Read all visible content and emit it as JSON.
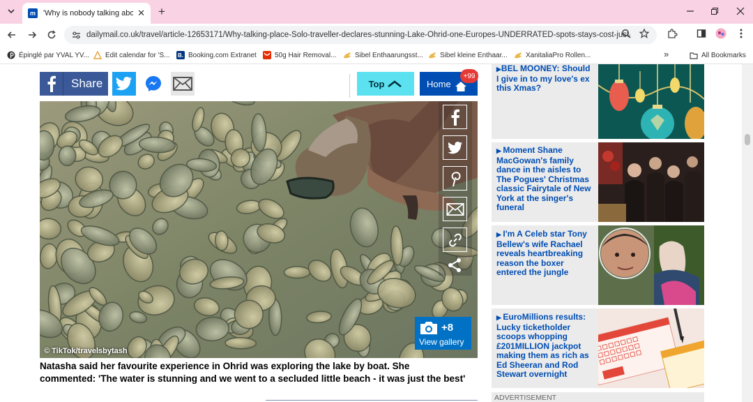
{
  "browser": {
    "tab_title": "'Why is nobody talking about t",
    "tab_favicon": "m",
    "url": "dailymail.co.uk/travel/article-12653171/Why-talking-place-Solo-traveller-declares-stunning-Lake-Ohrid-one-Europes-UNDERRATED-spots-stays-cost-just-...",
    "bookmarks": [
      {
        "label": "Épinglé par YVAL YV...",
        "icon": "pinterest-icon",
        "color": "#333333"
      },
      {
        "label": "Edit calendar for 'S...",
        "icon": "triangle-icon",
        "color": "#e8a33a"
      },
      {
        "label": "Booking.com Extranet",
        "icon": "booking-icon",
        "color": "#003580"
      },
      {
        "label": "50g Hair Removal...",
        "icon": "aliexpress-icon",
        "color": "#e62e04"
      },
      {
        "label": "Sibel Enthaarungsst...",
        "icon": "hand-icon",
        "color": "#e9b84a"
      },
      {
        "label": "Sibel kleine Enthaar...",
        "icon": "hand-icon",
        "color": "#e9b84a"
      },
      {
        "label": "XanitaliaPro Rollen...",
        "icon": "hand-icon",
        "color": "#e9b84a"
      }
    ],
    "all_bookmarks": "All Bookmarks",
    "more_bookmarks": "»"
  },
  "share": {
    "facebook_label": "Share",
    "top_label": "Top",
    "home_label": "Home",
    "home_badge": "+99"
  },
  "photo": {
    "credit": "© TikTok/travelsbytash",
    "gallery_count": "+8",
    "gallery_label": "View gallery"
  },
  "caption_lines": [
    "Natasha said her favourite experience in Ohrid was exploring the lake by boat. She",
    "commented: 'The water is stunning and we went to a secluded little beach - it was just the best'"
  ],
  "sidebar": {
    "stories": [
      {
        "lines": [
          "BEL MOONEY: Should",
          "I give in to my love's ex",
          "this Xmas?"
        ]
      },
      {
        "lines": [
          "Moment Shane",
          "MacGowan's family",
          "dance in the aisles to",
          "The Pogues' Christmas",
          "classic Fairytale of New",
          "York at the singer's",
          "funeral"
        ]
      },
      {
        "lines": [
          "I'm A Celeb star Tony",
          "Bellew's wife Rachael",
          "reveals heartbreaking",
          "reason the boxer",
          "entered the jungle"
        ]
      },
      {
        "lines": [
          "EuroMillions results:",
          "Lucky ticketholder",
          "scoops whopping",
          "£201MILLION jackpot",
          "making them as rich as",
          "Ed Sheeran and Rod",
          "Stewart overnight"
        ]
      }
    ],
    "advert_label": "ADVERTISEMENT"
  },
  "colors": {
    "tab_bar": "#f9d2e4",
    "facebook": "#3b5998",
    "twitter": "#1da1f2",
    "top_button": "#5ce1f0",
    "home_button": "#004db3",
    "link_blue": "#004db3",
    "gallery": "#0071c5"
  }
}
